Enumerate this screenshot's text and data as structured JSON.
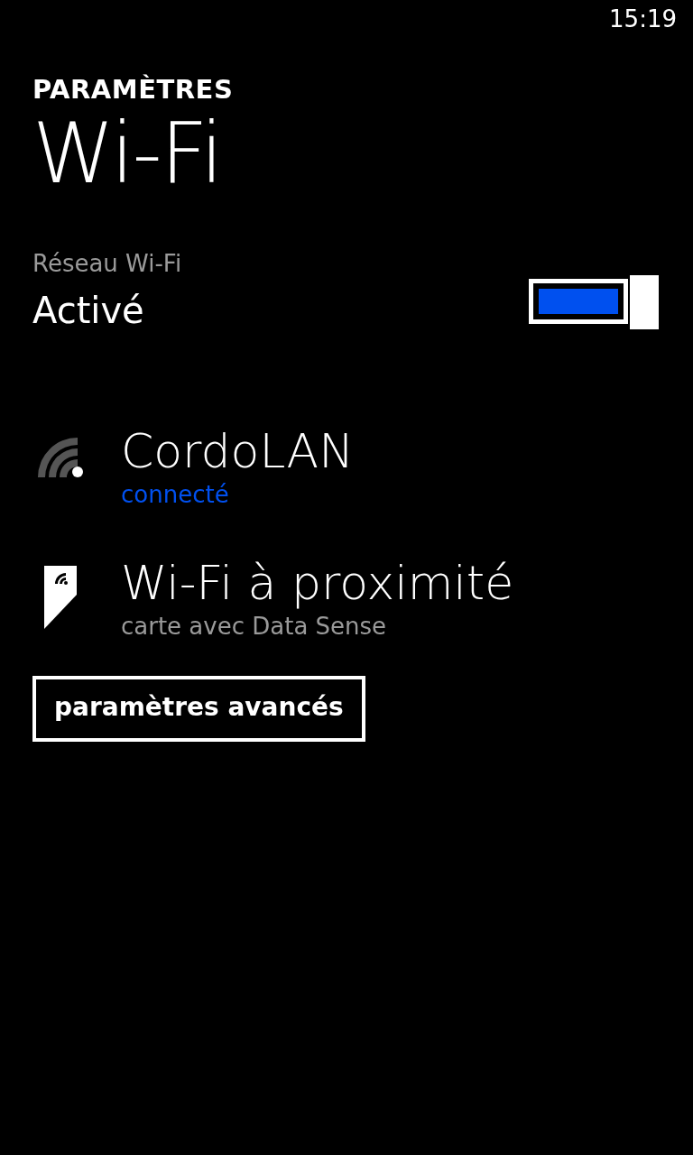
{
  "status_bar": {
    "time": "15:19"
  },
  "header": {
    "section": "PARAMÈTRES",
    "title": "Wi-Fi"
  },
  "wifi_toggle": {
    "label": "Réseau Wi-Fi",
    "state_text": "Activé",
    "on": true
  },
  "items": [
    {
      "kind": "network",
      "title": "CordoLAN",
      "subtitle": "connecté",
      "connected": true
    },
    {
      "kind": "app",
      "title": "Wi-Fi à proximité",
      "subtitle": "carte avec Data Sense",
      "connected": false
    }
  ],
  "advanced_button": {
    "label": "paramètres avancés"
  }
}
